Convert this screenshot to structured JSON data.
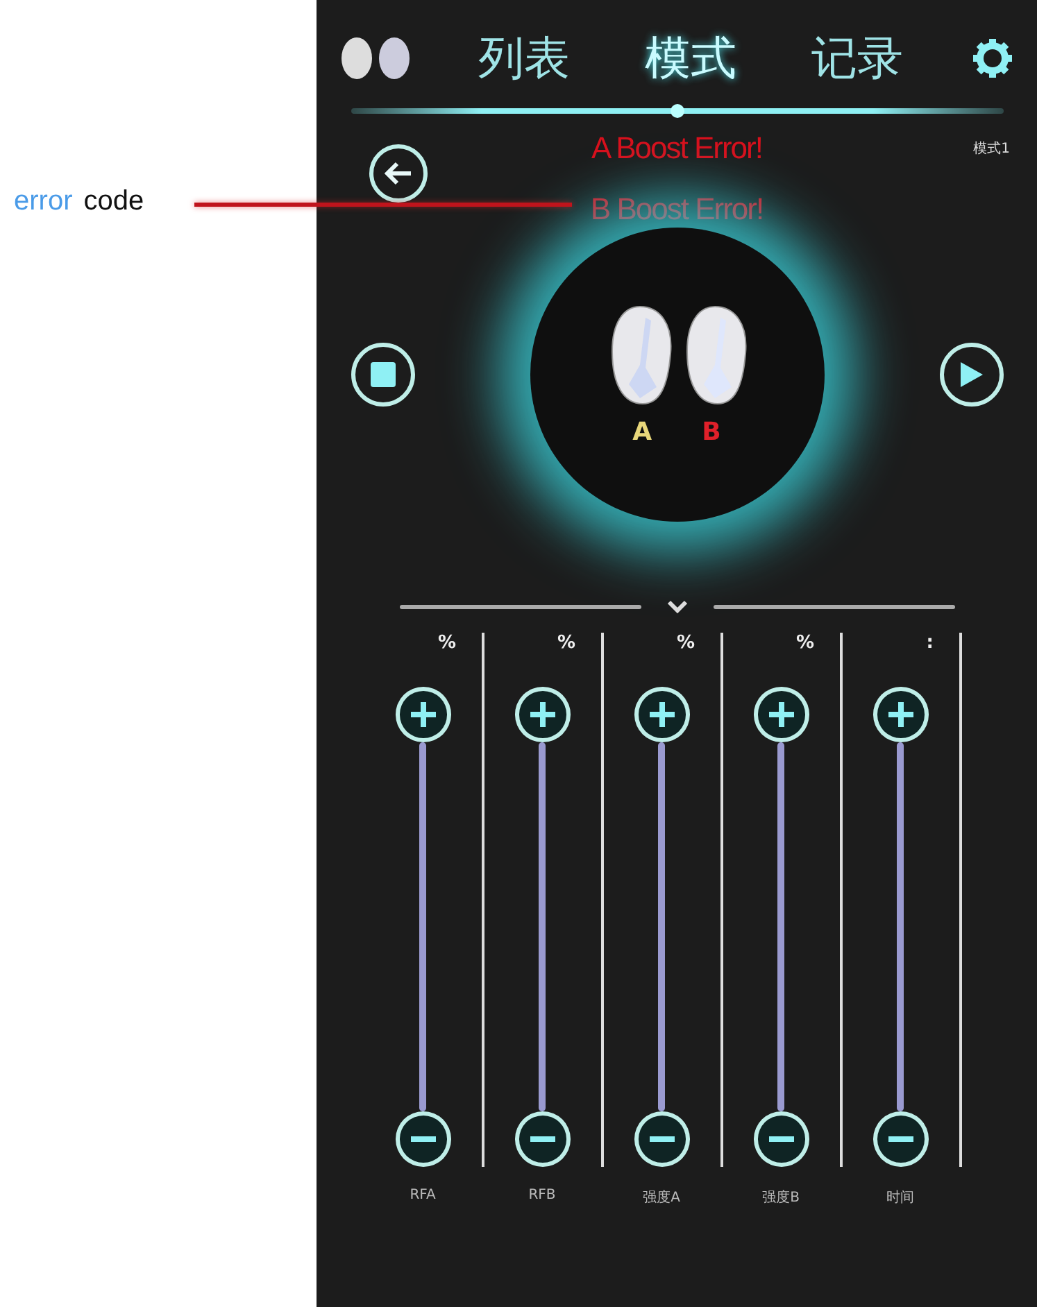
{
  "annotation": {
    "words": [
      {
        "text": "error",
        "color": "#4a9be8"
      },
      {
        "text": "code",
        "color": "#111111"
      }
    ]
  },
  "tabs": [
    {
      "label": "列表",
      "selected": false
    },
    {
      "label": "模式",
      "selected": true
    },
    {
      "label": "记录",
      "selected": false
    }
  ],
  "errors": [
    "A Boost Error!",
    "B Boost Error!"
  ],
  "mode_label": "模式1",
  "channels": [
    {
      "label": "A",
      "color": "#e8d77a"
    },
    {
      "label": "B",
      "color": "#e0202a"
    }
  ],
  "sliders": [
    {
      "unit": "%",
      "name": "RFA"
    },
    {
      "unit": "%",
      "name": "RFB"
    },
    {
      "unit": "%",
      "name": "强度A"
    },
    {
      "unit": "%",
      "name": "强度B"
    },
    {
      "unit": ":",
      "name": "时间"
    }
  ]
}
